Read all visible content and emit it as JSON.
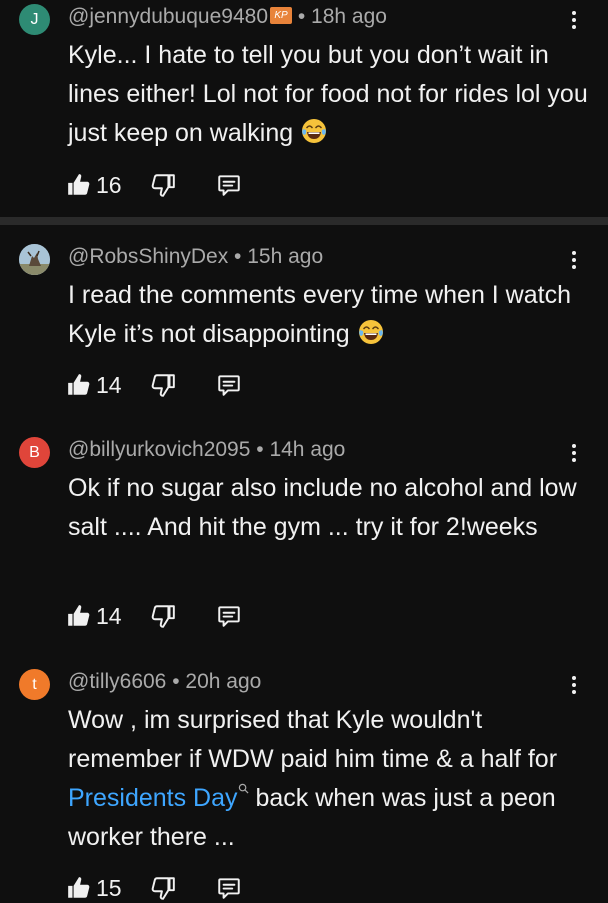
{
  "comments": [
    {
      "avatar_letter": "J",
      "avatar_color": "#2e8b74",
      "username": "@jennydubuque9480",
      "has_badge": true,
      "badge_text": "KP",
      "time": "18h ago",
      "text": "Kyle... I hate to tell you but you don’t wait in lines either! Lol not for food not for rides lol you just keep on walking",
      "emoji": "face-with-tears-of-joy",
      "likes": "16"
    },
    {
      "avatar_letter": "",
      "avatar_color": "#6b7d8c",
      "username": "@RobsShinyDex",
      "time": "15h ago",
      "text": "I read the comments every time when I watch Kyle it’s not disappointing",
      "emoji": "face-with-tears-of-joy",
      "likes": "14"
    },
    {
      "avatar_letter": "B",
      "avatar_color": "#e0453a",
      "username": "@billyurkovich2095",
      "time": "14h ago",
      "text": "Ok if no sugar also include no alcohol and low salt .... And hit the gym ... try it for 2!weeks",
      "likes": "14"
    },
    {
      "avatar_letter": "t",
      "avatar_color": "#f07a2a",
      "username": "@tilly6606",
      "time": "20h ago",
      "text_before": "Wow , im surprised that Kyle wouldn't remember if WDW paid him time & a half for ",
      "link_text": "Presidents Day",
      "text_after": " back when was just a peon worker there ...",
      "likes": "15"
    }
  ],
  "separator": " • ",
  "icons": [
    "thumbs-up-icon",
    "thumbs-down-icon",
    "reply-icon",
    "more-vert-icon",
    "search-icon",
    "laughing-emoji-icon"
  ],
  "colors": {
    "background": "#0f0f0f",
    "text": "#f1f1f1",
    "meta": "#aaaaaa",
    "link": "#3ea6ff",
    "divider": "#2a2a2a"
  }
}
